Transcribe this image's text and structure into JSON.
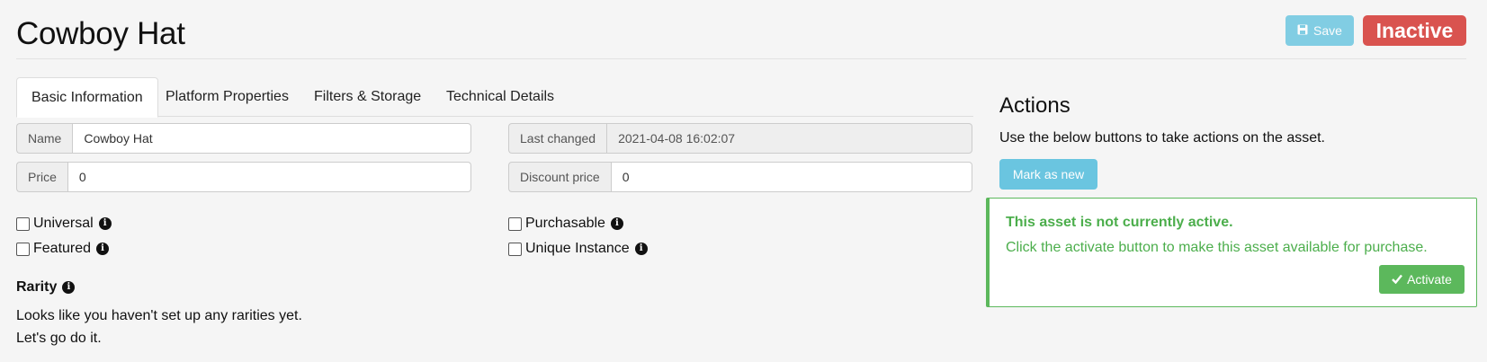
{
  "header": {
    "title": "Cowboy Hat",
    "save_label": "Save",
    "status_label": "Inactive"
  },
  "tabs": [
    {
      "label": "Basic Information",
      "active": true
    },
    {
      "label": "Platform Properties",
      "active": false
    },
    {
      "label": "Filters & Storage",
      "active": false
    },
    {
      "label": "Technical Details",
      "active": false
    }
  ],
  "fields": {
    "name": {
      "label": "Name",
      "value": "Cowboy Hat"
    },
    "price": {
      "label": "Price",
      "value": "0"
    },
    "last_changed": {
      "label": "Last changed",
      "value": "2021-04-08 16:02:07"
    },
    "discount_price": {
      "label": "Discount price",
      "value": "0"
    }
  },
  "checkboxes": {
    "universal": {
      "label": "Universal",
      "checked": false
    },
    "featured": {
      "label": "Featured",
      "checked": false
    },
    "purchasable": {
      "label": "Purchasable",
      "checked": false
    },
    "unique_instance": {
      "label": "Unique Instance",
      "checked": false
    }
  },
  "rarity": {
    "heading": "Rarity",
    "line1": "Looks like you haven't set up any rarities yet.",
    "line2": "Let's go do it."
  },
  "actions": {
    "title": "Actions",
    "description": "Use the below buttons to take actions on the asset.",
    "mark_new_label": "Mark as new",
    "alert_title": "This asset is not currently active.",
    "alert_text": "Click the activate button to make this asset available for purchase.",
    "activate_label": "Activate"
  },
  "icons": {
    "save": "floppy-disk-icon",
    "info": "info-circle-icon",
    "check": "checkmark-icon"
  },
  "colors": {
    "info": "#5bc0de",
    "danger": "#d9534f",
    "success": "#5cb85c"
  }
}
